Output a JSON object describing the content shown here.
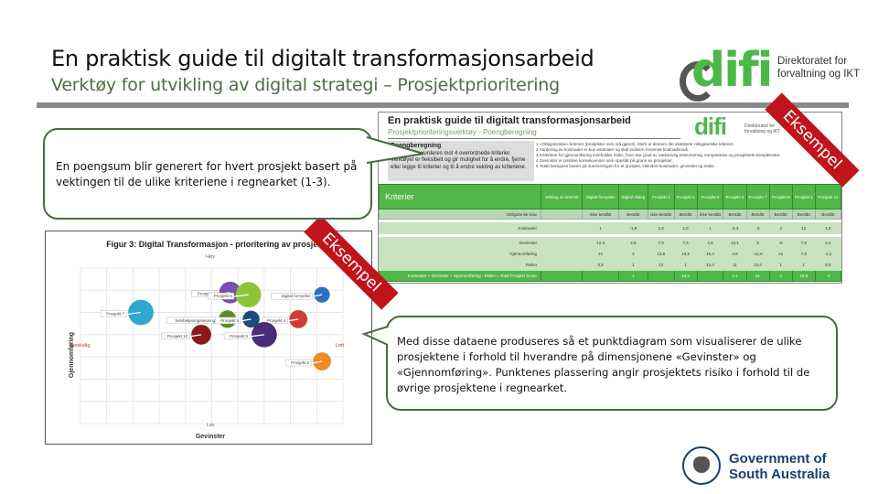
{
  "header": {
    "title": "En praktisk guide til digitalt transformasjonsarbeid",
    "subtitle": "Verktøy for utvikling av digital strategi – Prosjektprioritering"
  },
  "logos": {
    "difi": {
      "word": "difi",
      "tagline_line1": "Direktoratet for",
      "tagline_line2": "forvaltning og IKT",
      "color": "#4db848"
    },
    "sa_gov": {
      "line1": "Government of",
      "line2": "South Australia",
      "color": "#1c3f6e"
    }
  },
  "ribbon_label": "Eksempel",
  "spreadsheet": {
    "title": "En praktisk guide til digitalt transformasjonsarbeid",
    "subtitle": "Prosjektprioriteringsverktøy - Poengberegning",
    "box_heading": "Poengberegning",
    "box_text": "Prosjektene vurderes mot 4 overordnede kriterier. Verktøyet er fleksibelt og gir mulighet for å endre, fjerne eller legge til kriterier og til å endre vekting av kriteriene.",
    "notes": [
      "1  «Obligatoriske» kriterier (prosjekter som må gjøres). Merk ut dersom det eksisterer obligatoriske kriterier.",
      "2  Vurdering av kostnader er kun estimater og skal indikere forventet kostnadsnivå.",
      "3  Kriteriene for gjennomføring inneholder risiko, hvor stor grad av nødvendig ressursering, kompetanse og prosjektets kompleksitet.",
      "4  Gevinster er positive konsekvenser som oppstår på grunn av prosjektet.",
      "5  Totalt beregnes basert på summeringen for et prosjekt, inkludert kostnader, gevinster og risiko."
    ],
    "header_label": "Kriterier",
    "columns": [
      "Vekting av kriterier",
      "Digital fornyelse",
      "Digital dialog",
      "Prosjekt 2",
      "Prosjekt 4",
      "Prosjekt 6",
      "Prosjekt 5",
      "Prosjekt 7",
      "Prosjekt 8",
      "Prosjekt 1",
      "Prosjekt 12"
    ],
    "subheader": {
      "label": "Obligatorisk krav",
      "values": [
        "",
        "Ikke bestått",
        "Bestått",
        "Ikke bestått",
        "Bestått",
        "Ikke bestått",
        "Bestått",
        "Bestått",
        "Bestått",
        "Bestått",
        "Bestått"
      ]
    },
    "rows": [
      {
        "label": "Kostnader",
        "values": [
          "",
          "1",
          "-1,8",
          "1,5",
          "1,5",
          "1",
          "-3,3",
          "-3",
          "4",
          "12",
          "1,5"
        ]
      },
      {
        "label": "Gevinster",
        "values": [
          "",
          "12,4",
          "4,8",
          "7,5",
          "7,5",
          "4,8",
          "13,1",
          "9",
          "-8",
          "7,8",
          "4,4"
        ]
      },
      {
        "label": "Gjennomføring",
        "values": [
          "",
          "21",
          "3",
          "13,8",
          "16,5",
          "16,4",
          "4,8",
          "-12,6",
          "21",
          "7,8",
          "-1,1"
        ]
      },
      {
        "label": "Risiko",
        "values": [
          "",
          "6,8",
          "1",
          "12",
          "1",
          "12,4",
          "11",
          "12,4",
          "1",
          "1",
          "8,6"
        ]
      }
    ],
    "total": {
      "label": "Kostnader + Gevinster + Gjennomføring - Risiko = Total Prosjekt Score",
      "values": [
        "",
        "",
        "1",
        "",
        "15,3",
        "",
        "2,4",
        "21",
        "3",
        "16,9",
        "-3"
      ]
    }
  },
  "callouts": {
    "top": "En poengsum blir generert for hvert prosjekt basert på vektingen til de ulike kriteriene i regnearket (1-3).",
    "bottom": "Med disse dataene produseres så et punktdiagram som visualiserer de ulike prosjektene i forhold til hverandre på dimensjonene «Gevinster» og «Gjennomføring». Punktenes plassering angir prosjektets risiko i forhold til de øvrige prosjektene i regnearket."
  },
  "chart_data": {
    "type": "scatter",
    "title": "Figur 3: Digital Transformasjon - prioritering av prosjekter",
    "xlabel": "Gevinster",
    "ylabel": "Gjennomføring",
    "x_axis_labels": {
      "top": "Høy",
      "bottom": "Lav"
    },
    "y_axis_labels": {
      "left": "Vanskelig",
      "right": "Lett"
    },
    "xlim": [
      0,
      10
    ],
    "ylim": [
      0,
      7
    ],
    "grid": true,
    "points": [
      {
        "name": "Prosjekt 7",
        "x": 2.3,
        "y": 5.0,
        "size": 4.2,
        "color": "#2ea9cc"
      },
      {
        "name": "Prosjekt 3",
        "x": 5.7,
        "y": 5.9,
        "size": 3.6,
        "color": "#7b4fb0"
      },
      {
        "name": "Prosjekt 6",
        "x": 6.4,
        "y": 5.8,
        "size": 4.2,
        "color": "#8cc43c"
      },
      {
        "name": "Digital fornyelse",
        "x": 9.2,
        "y": 5.8,
        "size": 2.6,
        "color": "#2f6fbf"
      },
      {
        "name": "Selvbetjeningsløsning",
        "x": 5.6,
        "y": 4.7,
        "size": 2.9,
        "color": "#5a8a2e"
      },
      {
        "name": "Prosjekt 8",
        "x": 6.5,
        "y": 4.7,
        "size": 2.8,
        "color": "#1f4a7e"
      },
      {
        "name": "Prosjekt 4",
        "x": 8.3,
        "y": 4.7,
        "size": 3.0,
        "color": "#d23a3a"
      },
      {
        "name": "Prosjekt 12",
        "x": 4.6,
        "y": 4.0,
        "size": 3.3,
        "color": "#8b1a1a"
      },
      {
        "name": "Prosjekt 5",
        "x": 7.0,
        "y": 4.0,
        "size": 4.2,
        "color": "#4a2b7a"
      },
      {
        "name": "Prosjekt 2",
        "x": 9.2,
        "y": 2.8,
        "size": 3.0,
        "color": "#f08a24"
      }
    ]
  }
}
